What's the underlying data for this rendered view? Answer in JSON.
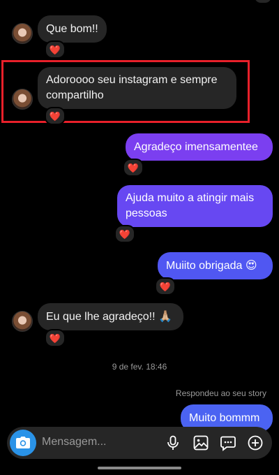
{
  "messages": [
    {
      "text": "Que bom!!",
      "reaction": "❤️"
    },
    {
      "text_line1": "Adoroooo seu instagram e sempre",
      "text_line2": "compartilho",
      "reaction": "❤️"
    },
    {
      "text": "Agradeço imensamentee",
      "reaction": "❤️"
    },
    {
      "text_line1": "Ajuda muito a atingir mais",
      "text_line2": "pessoas",
      "reaction": "❤️"
    },
    {
      "text": "Muiito obrigada 😍",
      "reaction": "❤️"
    },
    {
      "text": "Eu que lhe agradeço!! 🙏🏼",
      "reaction": "❤️"
    },
    {
      "text": "Muito bommm"
    }
  ],
  "timestamp": "9 de fev. 18:46",
  "story_reply_label": "Respondeu ao seu story",
  "composer": {
    "placeholder": "Mensagem...",
    "icons": [
      "camera-icon",
      "microphone-icon",
      "gallery-icon",
      "sticker-icon",
      "plus-icon"
    ]
  },
  "colors": {
    "incoming_bubble": "#262626",
    "outgoing_top": "#7b3ff0",
    "outgoing_bottom": "#4b63f2",
    "heart": "#ff2b3d",
    "highlight_border": "#e8202a",
    "camera_button": "#2a93e8"
  }
}
